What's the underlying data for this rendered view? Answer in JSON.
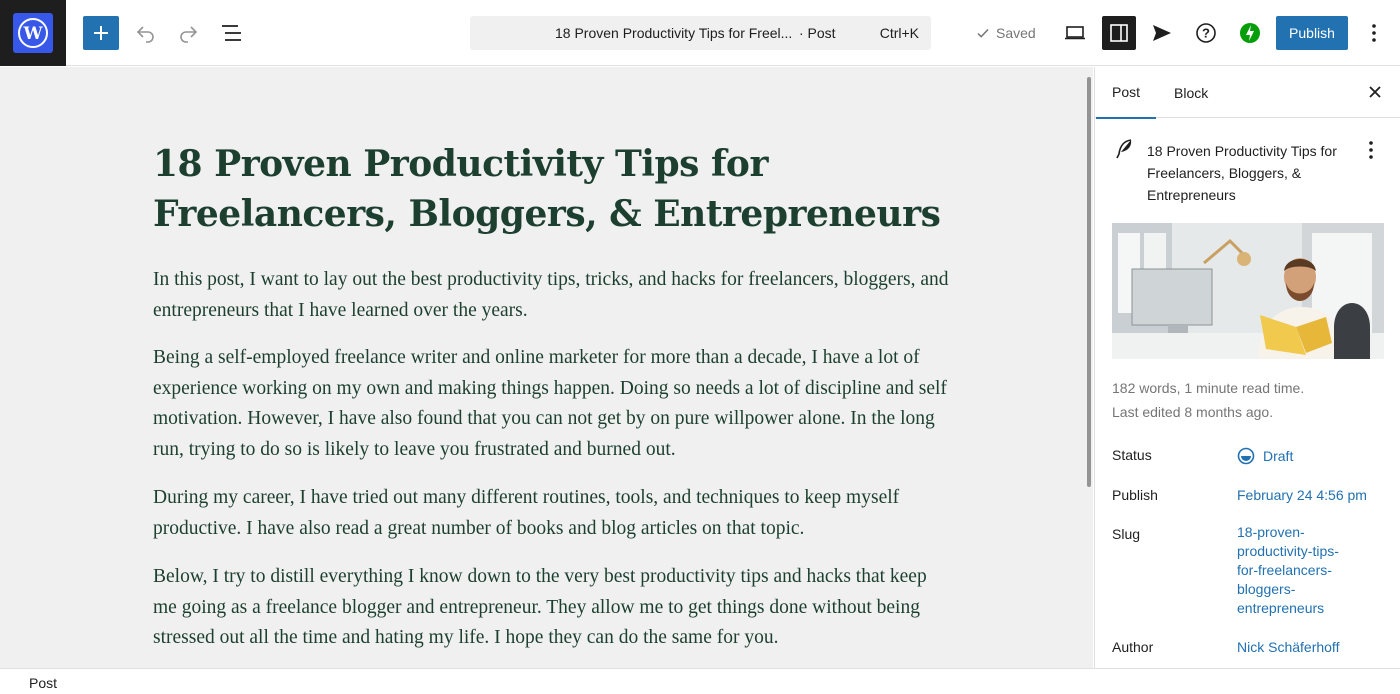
{
  "topbar": {
    "command_title": "18 Proven Productivity Tips for Freel...",
    "command_type": "· Post",
    "command_shortcut": "Ctrl+K",
    "saved_label": "Saved",
    "publish_label": "Publish"
  },
  "post": {
    "title": "18 Proven Productivity Tips for Freelancers, Bloggers, & Entrepreneurs",
    "paragraphs": [
      "In this post, I want to lay out the best productivity tips, tricks, and hacks for freelancers, bloggers, and entrepreneurs that I have learned over the years.",
      "Being a self-employed freelance writer and online marketer for more than a decade, I have a lot of experience working on my own and making things happen. Doing so needs a lot of discipline and self motivation. However, I have also found that you can not get by on pure willpower alone. In the long run, trying to do so is likely to leave you frustrated and burned out.",
      "During my career, I have tried out many different routines, tools, and techniques to keep myself productive. I have also read a great number of books and blog articles on that topic.",
      "Below, I try to distill everything I know down to the very best productivity tips and hacks that keep me going as a freelance blogger and entrepreneur. They allow me to get things done without being stressed out all the time and hating my life. I hope they can do the same for you."
    ]
  },
  "sidebar": {
    "tabs": [
      "Post",
      "Block"
    ],
    "card_title": "18 Proven Productivity Tips for Freelancers, Bloggers, & Entrepreneurs",
    "meta_words": "182 words, 1 minute read time.",
    "meta_edited": "Last edited 8 months ago.",
    "status_label": "Status",
    "status_value": "Draft",
    "publish_label": "Publish",
    "publish_value": "February 24 4:56 pm",
    "slug_label": "Slug",
    "slug_value": "18-proven-productivity-tips-for-freelancers-bloggers-entrepreneurs",
    "author_label": "Author",
    "author_value": "Nick Schäferhoff"
  },
  "footer": {
    "breadcrumb": "Post"
  },
  "colors": {
    "accent": "#2271b1",
    "wp_blue": "#3858e9",
    "title_green": "#1c3f2f",
    "jetpack": "#069e08"
  },
  "icons": [
    "wordpress-logo-icon",
    "plus-icon",
    "undo-icon",
    "redo-icon",
    "list-view-icon",
    "check-icon",
    "desktop-view-icon",
    "sidebar-settings-icon",
    "send-icon",
    "help-icon",
    "jetpack-icon",
    "more-vertical-icon",
    "close-icon",
    "feather-icon",
    "draft-status-icon"
  ]
}
